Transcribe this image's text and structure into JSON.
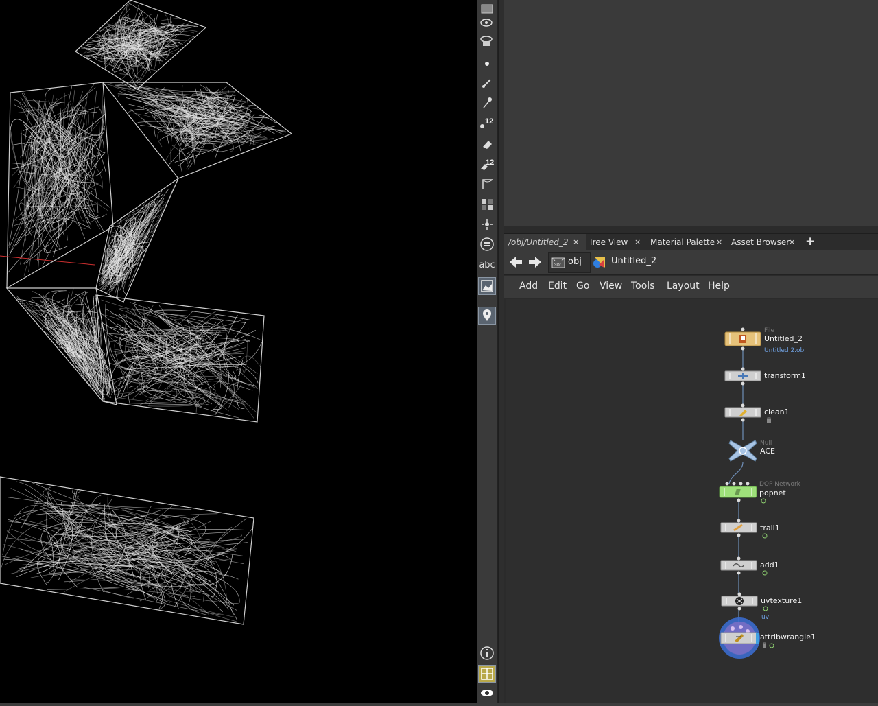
{
  "toolbar": {
    "text_tool_label": "abc",
    "tools": [
      "view-icon",
      "eye-icon",
      "camera-icon",
      "point-icon",
      "brush-icon",
      "pin-icon",
      "measure-icon",
      "eraser-icon",
      "measure-count-icon",
      "corner-icon",
      "grid-icon",
      "light-icon",
      "menu-icon",
      "text-icon",
      "image-icon",
      "location-icon",
      "info-icon",
      "layout-icon",
      "visibility-icon"
    ],
    "badge_12": "12"
  },
  "tabs": [
    {
      "label": "/obj/Untitled_2",
      "active": true
    },
    {
      "label": "Tree View",
      "active": false
    },
    {
      "label": "Material Palette",
      "active": false
    },
    {
      "label": "Asset Browser",
      "active": false
    }
  ],
  "tab_close": "×",
  "tab_add": "+",
  "nav": {
    "context": "obj",
    "path": "Untitled_2"
  },
  "menu": [
    "Add",
    "Edit",
    "Go",
    "View",
    "Tools",
    "Layout",
    "Help"
  ],
  "nodes": [
    {
      "name": "Untitled_2",
      "type": "File",
      "sub": "Untitled 2.obj",
      "color": "#e6c27a"
    },
    {
      "name": "transform1",
      "type": "",
      "sub": "",
      "color": "#cfcfcf"
    },
    {
      "name": "clean1",
      "type": "",
      "sub": "",
      "color": "#cfcfcf"
    },
    {
      "name": "ACE",
      "type": "Null",
      "sub": "",
      "color": "#a8c4e4"
    },
    {
      "name": "popnet",
      "type": "DOP Network",
      "sub": "",
      "color": "#9ee07a"
    },
    {
      "name": "trail1",
      "type": "",
      "sub": "",
      "color": "#cfcfcf"
    },
    {
      "name": "add1",
      "type": "",
      "sub": "",
      "color": "#cfcfcf"
    },
    {
      "name": "uvtexture1",
      "type": "",
      "sub": "uv",
      "color": "#cfcfcf"
    },
    {
      "name": "attribwrangle1",
      "type": "",
      "sub": "",
      "color": "#cfcfcf"
    }
  ],
  "colors": {
    "viewport_bg": "#000000",
    "panel_bg": "#3a3a3a",
    "network_bg": "#2e2e2e",
    "selection": "#3b6fd6",
    "wire": "#6f8fb8"
  }
}
